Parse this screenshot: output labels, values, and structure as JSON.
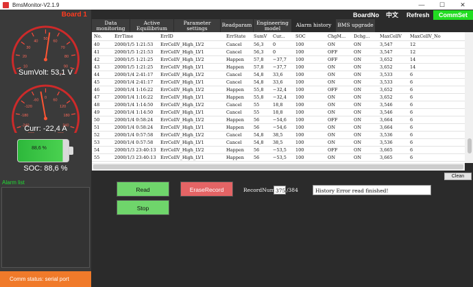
{
  "window": {
    "title": "BmsMonitor-V2.1.9",
    "minimize": "—",
    "maximize": "☐",
    "close": "✕"
  },
  "left": {
    "board": "Board 1",
    "sumvolt_label": "SumVolt: 53,1 V",
    "curr_label": "Curr: -22,4 A",
    "soc_label": "SOC: 88,6 %",
    "battery_text": "88,6 %",
    "soc_fraction": 0.886,
    "volt_gauge": {
      "value": 53.1,
      "min": 0,
      "max": 100,
      "ticks": [
        "0",
        "10",
        "20",
        "30",
        "40",
        "50",
        "60",
        "70",
        "80",
        "90",
        "100"
      ]
    },
    "curr_gauge": {
      "value": -22.4,
      "min": -300,
      "max": 300,
      "ticks": [
        "-300",
        "-240",
        "-180",
        "-120",
        "-60",
        "0",
        "60",
        "120",
        "180",
        "240",
        "300"
      ]
    },
    "alarm_list_label": "Alarm list",
    "comm_status": "Comm status: serial port"
  },
  "topbar": {
    "board_no": "BoardNo",
    "lang": "中文",
    "refresh": "Refresh",
    "commset": "CommSet"
  },
  "tabs": [
    {
      "line1": "Data",
      "line2": "monitoring"
    },
    {
      "line1": "Active",
      "line2": "Equilibrium"
    },
    {
      "line1": "Parameter",
      "line2": "settings"
    },
    {
      "line1": "Readparam",
      "line2": ""
    },
    {
      "line1": "Engineering",
      "line2": "model"
    },
    {
      "line1": "Alarm history",
      "line2": ""
    },
    {
      "line1": "BMS upgrade",
      "line2": ""
    }
  ],
  "table": {
    "columns": [
      "No.",
      "ErrTime",
      "ErrID",
      "ErrState",
      "SumV",
      "Cur...",
      "SOC",
      "ChgM...",
      "Dchg...",
      "MaxCellV",
      "MaxCellV_No"
    ],
    "rows": [
      [
        "40",
        "2000/1/5 1:21:53",
        "ErrCellV_High_LV2",
        "Cancel",
        "56,3",
        "0",
        "100",
        "ON",
        "ON",
        "3,547",
        "12"
      ],
      [
        "41",
        "2000/1/5 1:21:53",
        "ErrCellV_High_LV1",
        "Cancel",
        "56,3",
        "0",
        "100",
        "OFF",
        "ON",
        "3,547",
        "12"
      ],
      [
        "42",
        "2000/1/5 1:21:25",
        "ErrCellV_High_LV2",
        "Happen",
        "57,8",
        "−37,7",
        "100",
        "OFF",
        "ON",
        "3,652",
        "14"
      ],
      [
        "43",
        "2000/1/5 1:21:25",
        "ErrCellV_High_LV1",
        "Happen",
        "57,8",
        "−37,7",
        "100",
        "ON",
        "ON",
        "3,652",
        "14"
      ],
      [
        "44",
        "2000/1/4 2:41:17",
        "ErrCellV_High_LV2",
        "Cancel",
        "54,8",
        "33,6",
        "100",
        "ON",
        "ON",
        "3,533",
        "6"
      ],
      [
        "45",
        "2000/1/4 2:41:17",
        "ErrCellV_High_LV1",
        "Cancel",
        "54,8",
        "33,6",
        "100",
        "ON",
        "ON",
        "3,533",
        "6"
      ],
      [
        "46",
        "2000/1/4 1:16:22",
        "ErrCellV_High_LV2",
        "Happen",
        "55,8",
        "−32,4",
        "100",
        "OFF",
        "ON",
        "3,652",
        "6"
      ],
      [
        "47",
        "2000/1/4 1:16:22",
        "ErrCellV_High_LV1",
        "Happen",
        "55,8",
        "−32,4",
        "100",
        "ON",
        "ON",
        "3,652",
        "6"
      ],
      [
        "48",
        "2000/1/4 1:14:50",
        "ErrCellV_High_LV2",
        "Cancel",
        "55",
        "18,8",
        "100",
        "ON",
        "ON",
        "3,546",
        "6"
      ],
      [
        "49",
        "2000/1/4 1:14:50",
        "ErrCellV_High_LV1",
        "Cancel",
        "55",
        "18,8",
        "100",
        "ON",
        "ON",
        "3,546",
        "6"
      ],
      [
        "50",
        "2000/1/4 0:58:24",
        "ErrCellV_High_LV2",
        "Happen",
        "56",
        "−54,6",
        "100",
        "OFF",
        "ON",
        "3,664",
        "6"
      ],
      [
        "51",
        "2000/1/4 0:58:24",
        "ErrCellV_High_LV1",
        "Happen",
        "56",
        "−54,6",
        "100",
        "ON",
        "ON",
        "3,664",
        "6"
      ],
      [
        "52",
        "2000/1/4 0:57:58",
        "ErrCellV_High_LV2",
        "Cancel",
        "54,8",
        "38,5",
        "100",
        "ON",
        "ON",
        "3,536",
        "6"
      ],
      [
        "53",
        "2000/1/4 0:57:58",
        "ErrCellV_High_LV1",
        "Cancel",
        "54,8",
        "38,5",
        "100",
        "ON",
        "ON",
        "3,536",
        "6"
      ],
      [
        "54",
        "2000/1/3 23:40:13",
        "ErrCellV_High_LV2",
        "Happen",
        "56",
        "−53,5",
        "100",
        "OFF",
        "ON",
        "3,665",
        "6"
      ],
      [
        "55",
        "2000/1/3 23:40:13",
        "ErrCellV_High_LV1",
        "Happen",
        "56",
        "−53,5",
        "100",
        "ON",
        "ON",
        "3,665",
        "6"
      ],
      [
        "56",
        "2000/1/3 23:40:13",
        "ErrCellV_High_LV1",
        "Cancel",
        "54,9",
        "20,7",
        "100",
        "ON",
        "ON",
        "3,544",
        "6"
      ]
    ]
  },
  "controls": {
    "clean": "Clean",
    "read": "Read",
    "stop": "Stop",
    "erase": "EraseRecord",
    "record_num_label": "RecordNum",
    "record_num_value": "375",
    "record_total": "/384",
    "status_text": "History Error read finished!"
  },
  "colors": {
    "accent_green": "#22dd22",
    "board_red": "#ff3b1f",
    "comm_orange": "#f07a2a",
    "erase_red": "#e46465",
    "button_green": "#6fd56b"
  }
}
